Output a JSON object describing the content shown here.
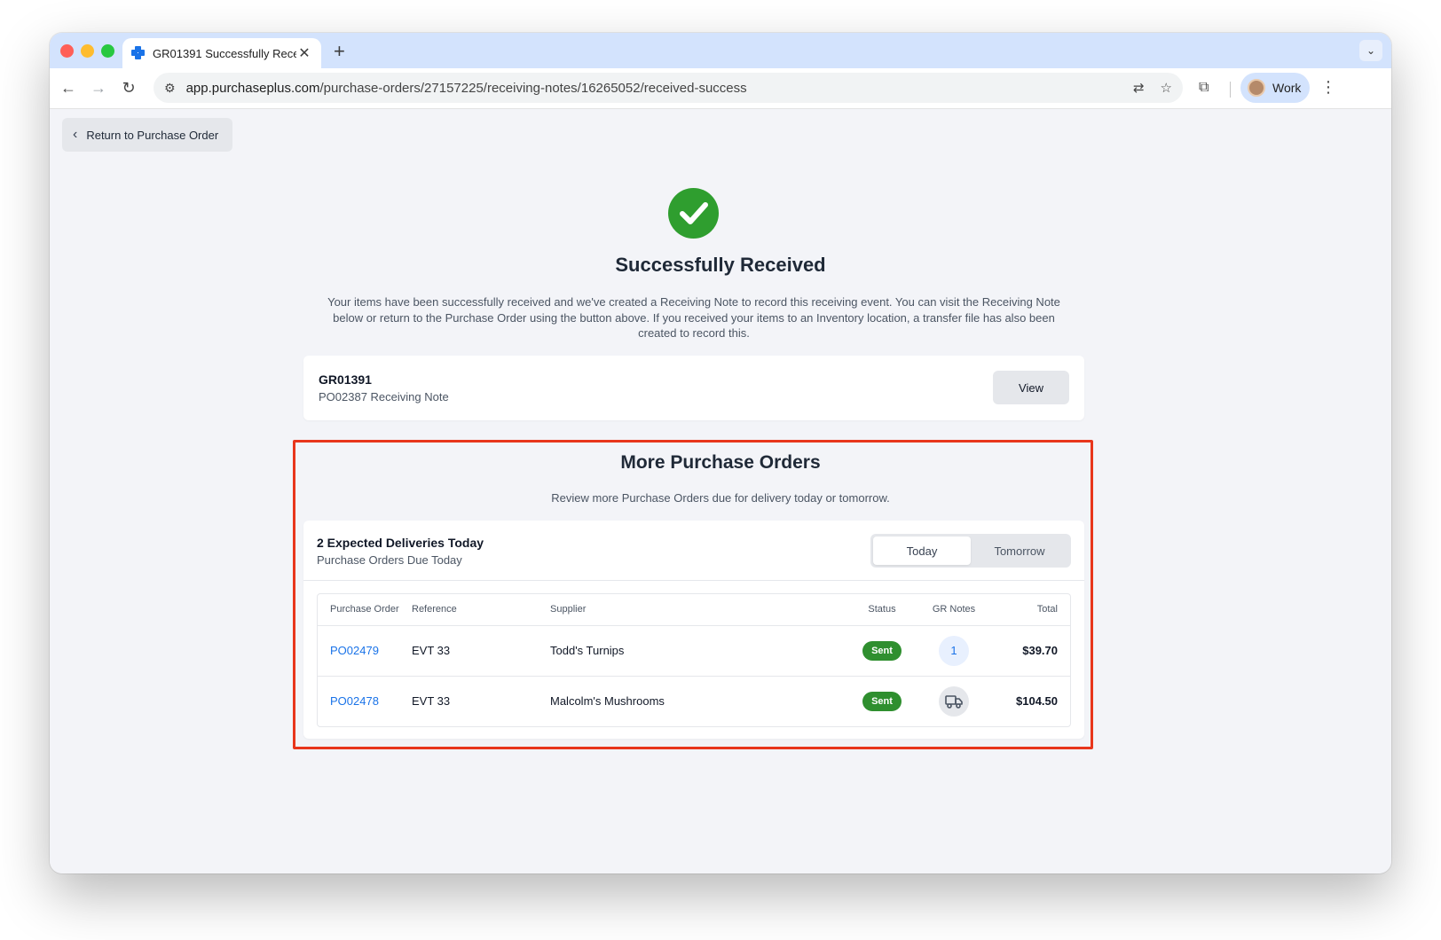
{
  "browser": {
    "tab_title": "GR01391 Successfully Receiv",
    "new_tab_symbol": "+",
    "close_symbol": "✕",
    "url_domain": "app.purchaseplus.com",
    "url_path": "/purchase-orders/27157225/receiving-notes/16265052/received-success",
    "profile_name": "Work"
  },
  "page": {
    "back_button": "Return to Purchase Order",
    "title": "Successfully Received",
    "description": "Your items have been successfully received and we've created a Receiving Note to record this receiving event. You can visit the Receiving Note below or return to the Purchase Order using the button above. If you received your items to an Inventory location, a transfer file has also been created to record this.",
    "receiving_note": {
      "number": "GR01391",
      "subtitle": "PO02387 Receiving Note",
      "view_label": "View"
    }
  },
  "more_orders": {
    "title": "More Purchase Orders",
    "description": "Review more Purchase Orders due for delivery today or tomorrow.",
    "card_title": "2 Expected Deliveries Today",
    "card_subtitle": "Purchase Orders Due Today",
    "toggle": {
      "today": "Today",
      "tomorrow": "Tomorrow",
      "selected": "Today"
    },
    "columns": [
      "Purchase Order",
      "Reference",
      "Supplier",
      "Status",
      "GR Notes",
      "Total"
    ],
    "rows": [
      {
        "po": "PO02479",
        "reference": "EVT 33",
        "supplier": "Todd's Turnips",
        "status": "Sent",
        "gr_notes": "1",
        "gr_icon": "",
        "total": "$39.70"
      },
      {
        "po": "PO02478",
        "reference": "EVT 33",
        "supplier": "Malcolm's Mushrooms",
        "status": "Sent",
        "gr_notes": "",
        "gr_icon": "truck-icon",
        "total": "$104.50"
      }
    ]
  },
  "colors": {
    "accent": "#1a73e8",
    "success": "#2f9e2f",
    "highlight": "#e8361c"
  }
}
